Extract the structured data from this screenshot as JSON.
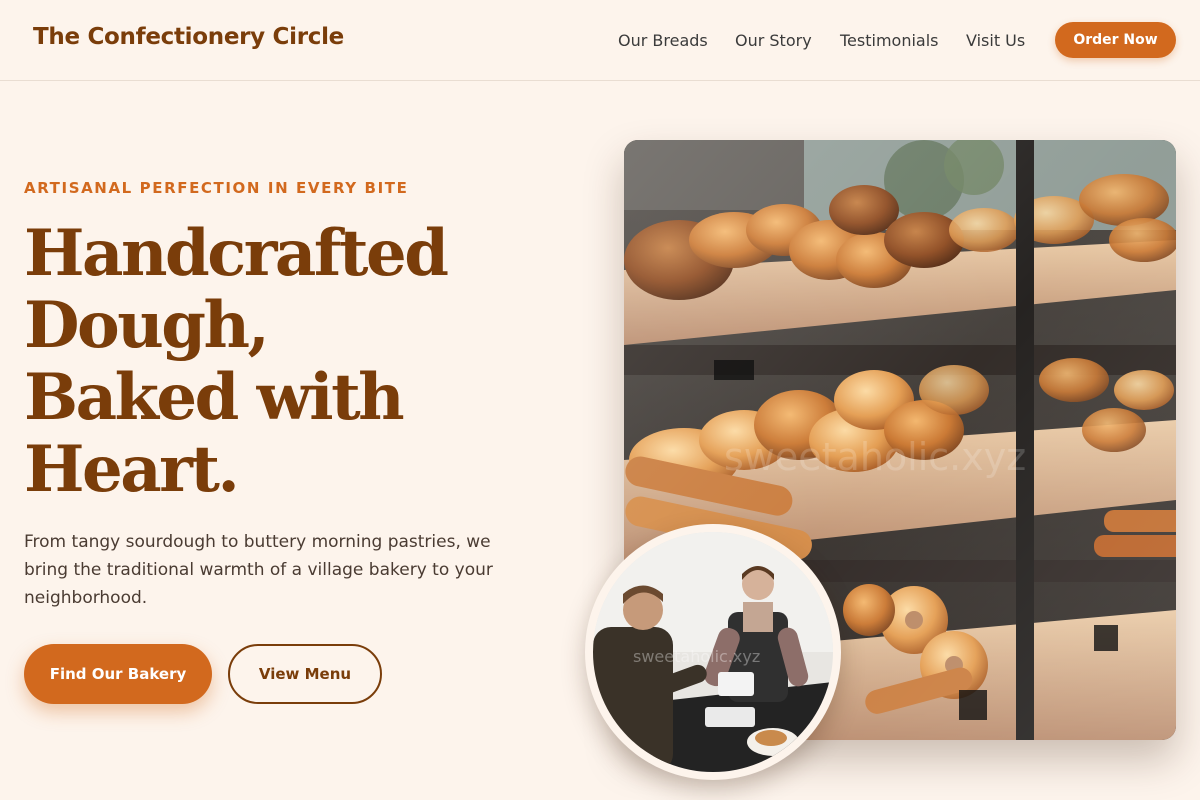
{
  "nav": {
    "brand": "The Confectionery Circle",
    "links": [
      "Our Breads",
      "Our Story",
      "Testimonials",
      "Visit Us"
    ],
    "cta": "Order Now"
  },
  "hero": {
    "eyebrow": "ARTISANAL PERFECTION IN EVERY BITE",
    "headline_lines": [
      "Handcrafted",
      "Dough,",
      "Baked with",
      "Heart."
    ],
    "lead": "From tangy sourdough to buttery morning pastries, we bring the traditional warmth of a village bakery to your neighborhood.",
    "primary_button": "Find Our Bakery",
    "secondary_button": "View Menu"
  },
  "images": {
    "main_photo_watermark": "sweetaholic.xyz",
    "inset_photo_watermark": "sweetaholic.xyz"
  },
  "colors": {
    "background": "#fdf4ec",
    "accent": "#d2691e",
    "brand_brown": "#7a3d0a"
  }
}
